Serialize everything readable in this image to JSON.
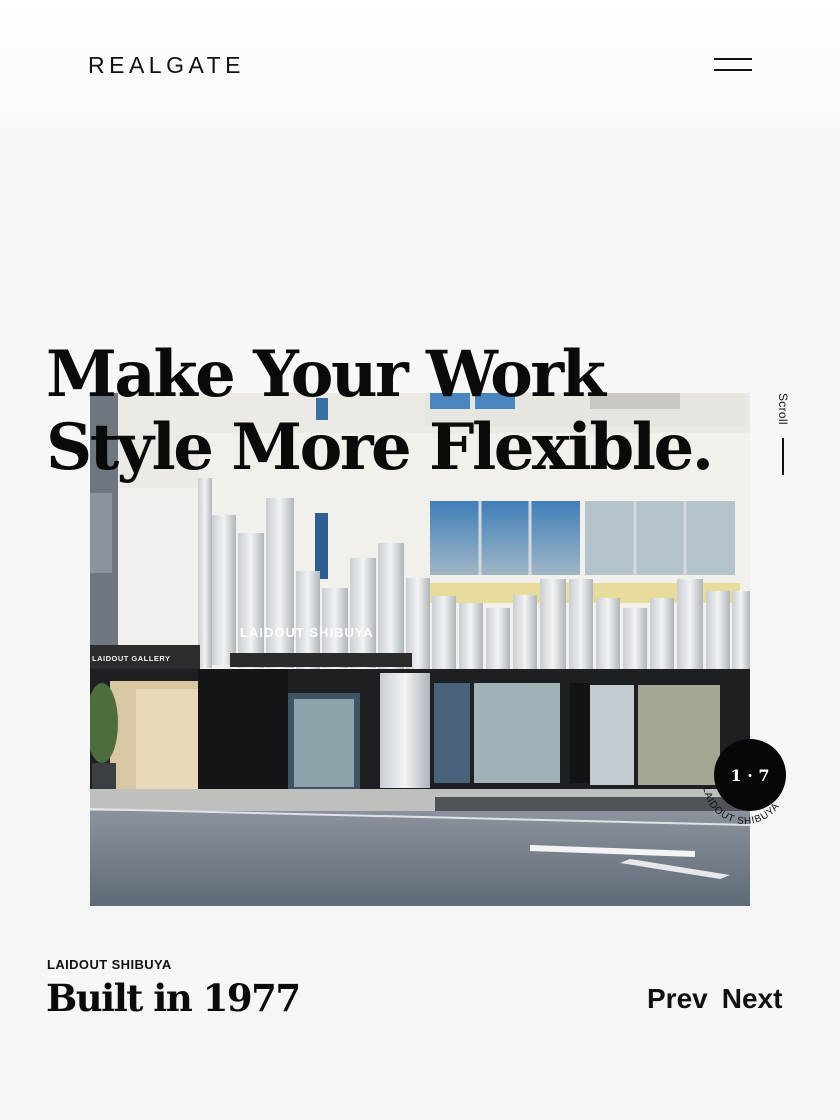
{
  "header": {
    "logo": "REALGATE",
    "menu_icon": "hamburger-icon"
  },
  "hero": {
    "headline_line1": "Make Your Work",
    "headline_line2": "Style More Flexible.",
    "photo_signage": {
      "facade_sign": "LAIDOUT SHIBUYA",
      "gallery_sign": "LAIDOUT GALLERY"
    }
  },
  "scroll": {
    "label": "Scroll"
  },
  "slide_counter": {
    "text": "1 · 7",
    "ring_label": "LAIDOUT SHIBUYA"
  },
  "project": {
    "label": "LAIDOUT SHIBUYA",
    "title": "Built in 1977"
  },
  "pager": {
    "prev": "Prev",
    "next": "Next"
  }
}
